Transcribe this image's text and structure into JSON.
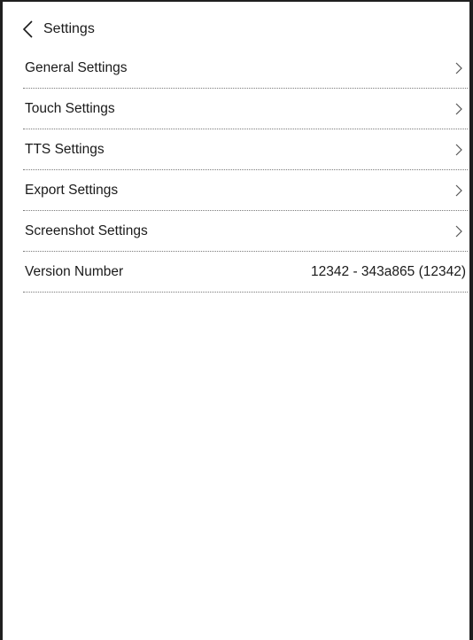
{
  "header": {
    "back_icon": "chevron-left-icon",
    "title": "Settings"
  },
  "menu": {
    "items": [
      {
        "label": "General Settings",
        "icon": "chevron-right-icon"
      },
      {
        "label": "Touch Settings",
        "icon": "chevron-right-icon"
      },
      {
        "label": "TTS Settings",
        "icon": "chevron-right-icon"
      },
      {
        "label": "Export Settings",
        "icon": "chevron-right-icon"
      },
      {
        "label": "Screenshot Settings",
        "icon": "chevron-right-icon"
      }
    ],
    "version": {
      "label": "Version Number",
      "value": "12342 - 343a865 (12342)"
    }
  },
  "colors": {
    "background": "#ffffff",
    "text": "#1a1a1a",
    "divider": "#7a7a7a",
    "frame": "#1f1f1f"
  }
}
